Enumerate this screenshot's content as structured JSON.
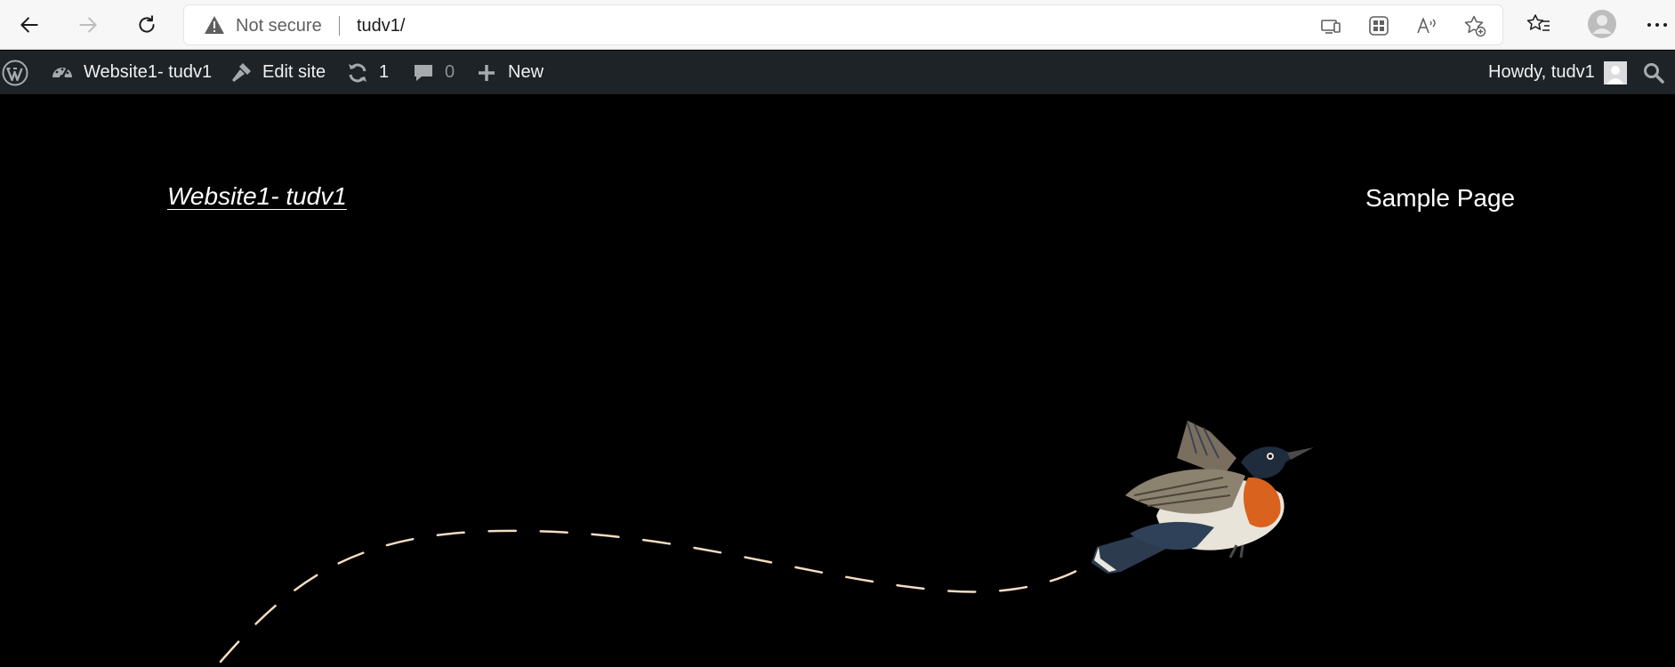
{
  "browser": {
    "back_icon": "back-arrow-icon",
    "forward_icon": "forward-arrow-icon",
    "reload_icon": "reload-icon",
    "security_warning_icon": "warning-triangle-icon",
    "security_label": "Not secure",
    "url": "tudv1/",
    "toolbar_icons": [
      "device-cast-icon",
      "apps-grid-icon",
      "read-aloud-icon",
      "add-favorite-icon",
      "favorites-icon",
      "profile-avatar-icon",
      "more-menu-icon"
    ]
  },
  "admin_bar": {
    "wp_logo_icon": "wordpress-logo-icon",
    "site_name": "Website1- tudv1",
    "edit_site": "Edit site",
    "updates_count": "1",
    "comments_count": "0",
    "new_label": "New",
    "howdy": "Howdy, tudv1",
    "colors": {
      "background": "#1d2327",
      "text": "#f0f0f1",
      "dim": "#8c8f94"
    }
  },
  "site": {
    "title": "Website1- tudv1",
    "nav": {
      "sample_page": "Sample Page"
    },
    "colors": {
      "background": "#000000",
      "path": "#f5dcc0"
    }
  }
}
